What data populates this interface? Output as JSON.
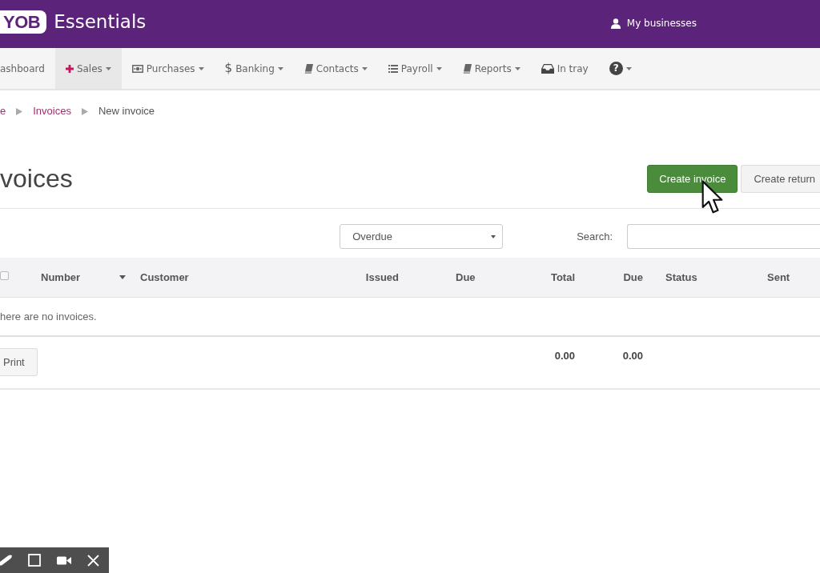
{
  "header": {
    "logo": "YOB",
    "product": "Essentials",
    "account_link": "My businesses"
  },
  "nav": [
    {
      "label": "ashboard",
      "selected": false,
      "dropdown": false
    },
    {
      "label": "Sales",
      "selected": true,
      "dropdown": true
    },
    {
      "label": "Purchases",
      "selected": false,
      "dropdown": true
    },
    {
      "symbol": "$",
      "label": "Banking",
      "selected": false,
      "dropdown": true
    },
    {
      "label": "Contacts",
      "selected": false,
      "dropdown": true
    },
    {
      "label": "Payroll",
      "selected": false,
      "dropdown": true
    },
    {
      "label": "Reports",
      "selected": false,
      "dropdown": true
    },
    {
      "label": "In tray",
      "selected": false,
      "dropdown": false
    },
    {
      "symbol": "?",
      "selected": false,
      "dropdown": true
    }
  ],
  "breadcrumb": [
    {
      "label": "e",
      "link": true
    },
    {
      "label": "Invoices",
      "link": true
    },
    {
      "label": "New invoice",
      "link": false
    }
  ],
  "page": {
    "title": "voices",
    "actions": [
      {
        "label": "Create invoice",
        "kind": "primary"
      },
      {
        "label": "Create return",
        "kind": "secondary"
      }
    ]
  },
  "filters": {
    "status": {
      "value": "Overdue"
    },
    "search": {
      "label": "Search:"
    }
  },
  "table": {
    "select_all": {
      "checked": false
    },
    "columns": [
      {
        "label": "Number",
        "sorted": true
      },
      {
        "label": "Customer",
        "sorted": false
      },
      {
        "label": "Issued",
        "sorted": false
      },
      {
        "label": "Due",
        "sorted": false
      },
      {
        "label": "Total",
        "sorted": false,
        "total": "0.00"
      },
      {
        "label": "Due",
        "sorted": false,
        "total": "0.00"
      },
      {
        "label": "Status",
        "sorted": false
      },
      {
        "label": "Sent",
        "sorted": false
      }
    ],
    "empty_message": "here are no invoices.",
    "print_button": "Print"
  }
}
